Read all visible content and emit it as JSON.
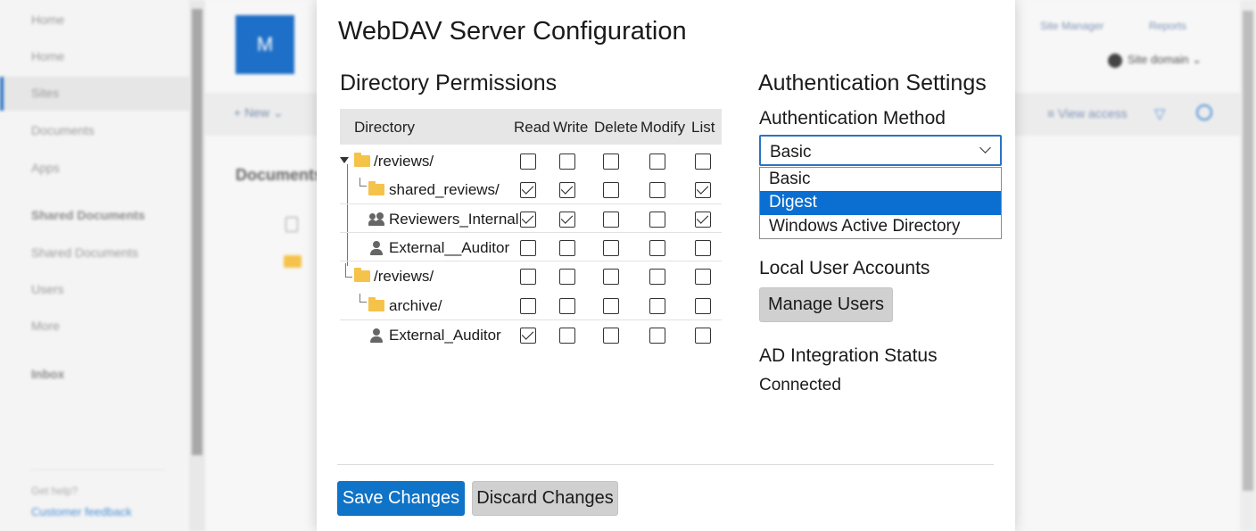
{
  "background": {
    "nav_items": [
      "Home",
      "Home",
      "Sites",
      "Documents",
      "Apps",
      "Shared Documents",
      "Shared Documents",
      "Users",
      "More",
      "Inbox"
    ],
    "help_label": "Get help?",
    "feedback_link": "Customer feedback",
    "site_initial": "M",
    "new_label": "+ New ⌄",
    "documents_heading": "Documents",
    "top_links": [
      "Site Manager",
      "Reports"
    ],
    "domain_label": "Site domain ⌄",
    "view_access_label": "≡ View access"
  },
  "dialog": {
    "title": "WebDAV Server Configuration",
    "permissions": {
      "title": "Directory Permissions",
      "columns": [
        "Directory",
        "Read",
        "Write",
        "Delete",
        "Modify",
        "List"
      ],
      "rows": [
        {
          "name": "/reviews/",
          "kind": "folder-root",
          "perms": [
            false,
            false,
            false,
            false,
            false
          ]
        },
        {
          "name": "shared_reviews/",
          "kind": "folder-child",
          "perms": [
            true,
            true,
            false,
            false,
            true
          ]
        },
        {
          "name": "Reviewers_Internal",
          "kind": "group",
          "perms": [
            true,
            true,
            false,
            false,
            true
          ]
        },
        {
          "name": "External__Auditor",
          "kind": "user",
          "perms": [
            false,
            false,
            false,
            false,
            false
          ]
        },
        {
          "name": "/reviews/",
          "kind": "folder-root2",
          "perms": [
            false,
            false,
            false,
            false,
            false
          ]
        },
        {
          "name": "archive/",
          "kind": "folder-child",
          "perms": [
            false,
            false,
            false,
            false,
            false
          ]
        },
        {
          "name": "External_Auditor",
          "kind": "user",
          "perms": [
            true,
            false,
            false,
            false,
            false
          ]
        }
      ]
    },
    "auth": {
      "title": "Authentication Settings",
      "method_label": "Authentication Method",
      "selected": "Basic",
      "options": [
        "Basic",
        "Digest",
        "Windows Active Directory"
      ],
      "highlighted_option": "Digest",
      "local_users_label": "Local User Accounts",
      "manage_users_button": "Manage Users",
      "ad_status_label": "AD Integration Status",
      "ad_status_value": "Connected"
    },
    "footer": {
      "save_button": "Save Changes",
      "discard_button": "Discard Changes"
    }
  },
  "colors": {
    "primary": "#0f73c8",
    "dropdown_highlight": "#0a6fd1",
    "folder": "#f5c24a"
  }
}
